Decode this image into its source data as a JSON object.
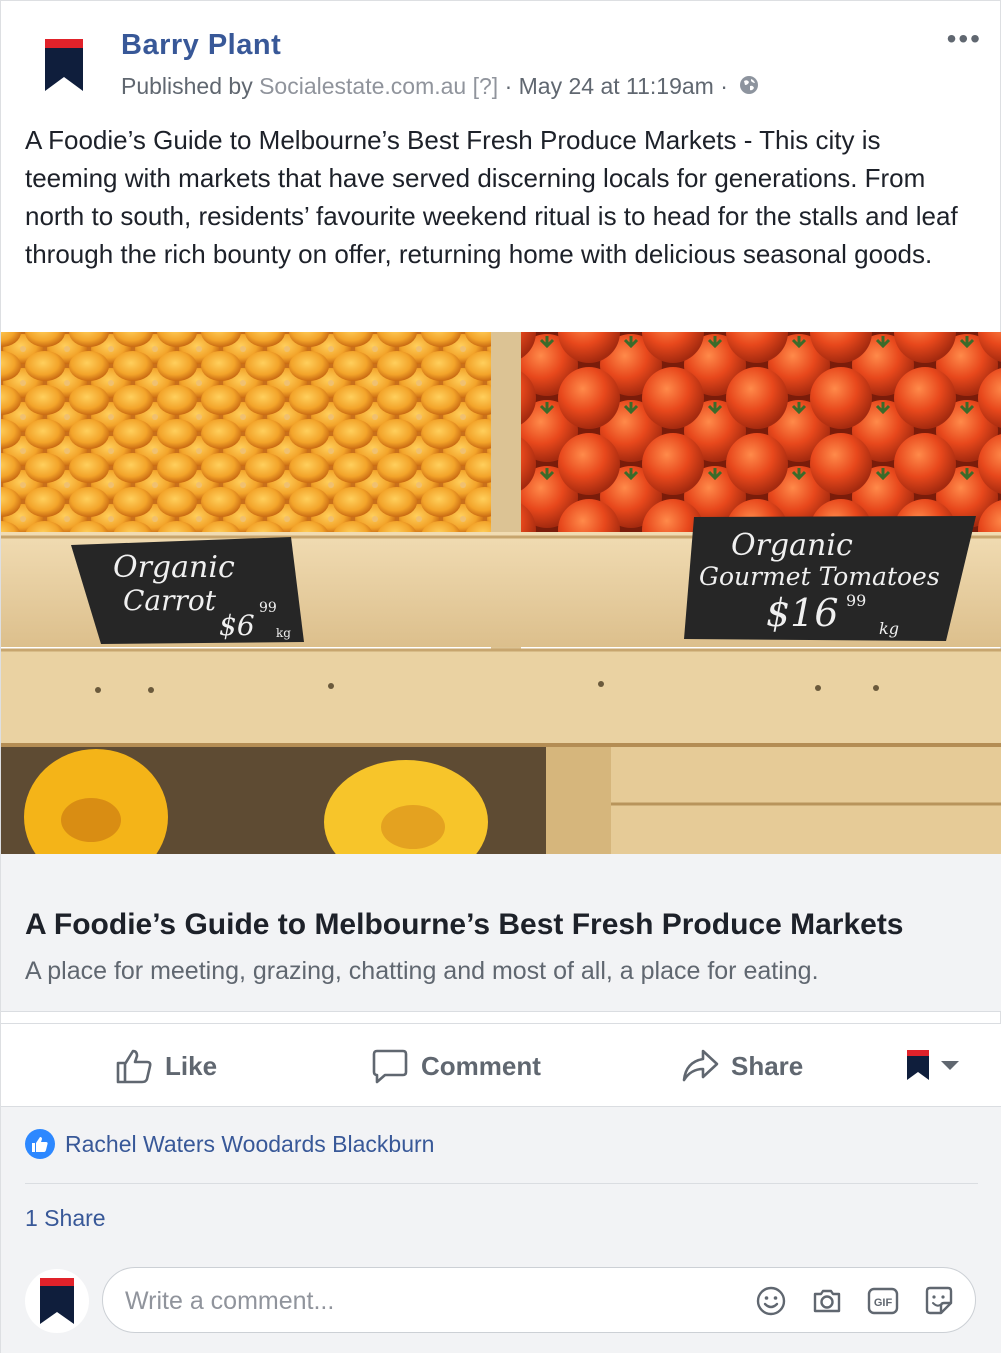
{
  "post": {
    "page_name": "Barry Plant",
    "published_by_prefix": "Published by",
    "publisher": "Socialestate.com.au",
    "help_marker": "[?]",
    "separator": "·",
    "date": "May 24 at 11:19am",
    "more_label": "•••",
    "body": "A Foodie’s Guide to Melbourne’s Best Fresh Produce Markets - This city is teeming with markets that have served discerning locals for generations. From north to south, residents’ favourite weekend ritual is to head for the stalls and leaf through the rich bounty on offer, returning home with delicious seasonal goods."
  },
  "photo": {
    "sign_left": [
      "Organic",
      "Carrot",
      "$6",
      "99",
      "kg"
    ],
    "sign_right": [
      "Organic",
      "Gourmet Tomatoes",
      "$16",
      "99",
      "kg"
    ]
  },
  "preview": {
    "title": "A Foodie’s Guide to Melbourne’s Best Fresh Produce Markets",
    "description": "A place for meeting, grazing, chatting and most of all, a place for eating."
  },
  "actions": {
    "like": "Like",
    "comment": "Comment",
    "share": "Share"
  },
  "footer": {
    "likes": "Rachel Waters Woodards Blackburn",
    "shares": "1 Share",
    "comment_placeholder": "Write a comment...",
    "gif_label": "GIF"
  },
  "colors": {
    "brand_navy": "#0f1e3c",
    "brand_red": "#e0222a",
    "link_blue": "#385898",
    "like_blue": "#2d88ff"
  },
  "icons": [
    "bookmark-logo-icon",
    "globe-icon",
    "more-icon",
    "like-icon",
    "comment-icon",
    "share-icon",
    "dropdown-caret-icon",
    "like-badge-icon",
    "emoji-icon",
    "camera-icon",
    "gif-icon",
    "sticker-icon"
  ]
}
